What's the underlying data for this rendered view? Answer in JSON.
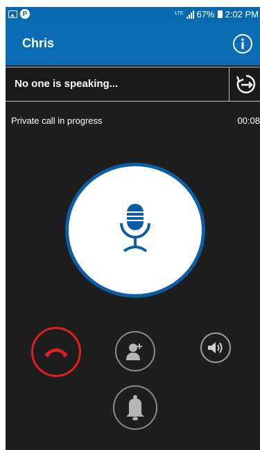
{
  "status_bar": {
    "network_label": "LTE",
    "battery_percent": "67%",
    "time": "2:02 PM",
    "left_icons": [
      "image-icon",
      "p-icon"
    ]
  },
  "header": {
    "contact_name": "Chris",
    "info_icon": "info-icon"
  },
  "speaker_bar": {
    "text": "No one is speaking...",
    "replay_icon": "replay-icon"
  },
  "call": {
    "status_text": "Private call in progress",
    "timer": "00:08"
  },
  "controls": {
    "mic_icon": "microphone-icon",
    "end_call_icon": "hang-up-phone-icon",
    "add_participant_icon": "add-person-icon",
    "speaker_icon": "speaker-volume-icon",
    "alert_icon": "bell-icon"
  },
  "colors": {
    "brand_blue": "#0b6bb3",
    "status_blue": "#0a6ab0",
    "background": "#1e1e1e",
    "end_call_red": "#e02020",
    "mic_blue": "#0b5ea6"
  }
}
